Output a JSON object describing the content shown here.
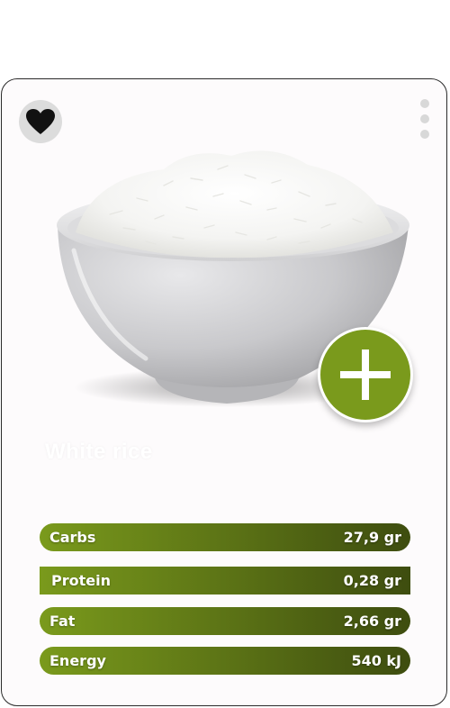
{
  "colors": {
    "accent_green": "#7a9a1c",
    "bar_gradient_start": "#7a9a1c",
    "bar_gradient_end": "#3e4d0f",
    "card_background": "#fdfbfc",
    "heart": "#111111"
  },
  "icons": {
    "favorite": "heart-icon",
    "menu": "kebab-menu-icon",
    "add": "plus-icon"
  },
  "food": {
    "name": "White rice"
  },
  "nutrients": [
    {
      "label": "Carbs",
      "value": "27,9 gr"
    },
    {
      "label": "Protein",
      "value": "0,28 gr"
    },
    {
      "label": "Fat",
      "value": "2,66 gr"
    },
    {
      "label": "Energy",
      "value": "540 kJ"
    }
  ]
}
